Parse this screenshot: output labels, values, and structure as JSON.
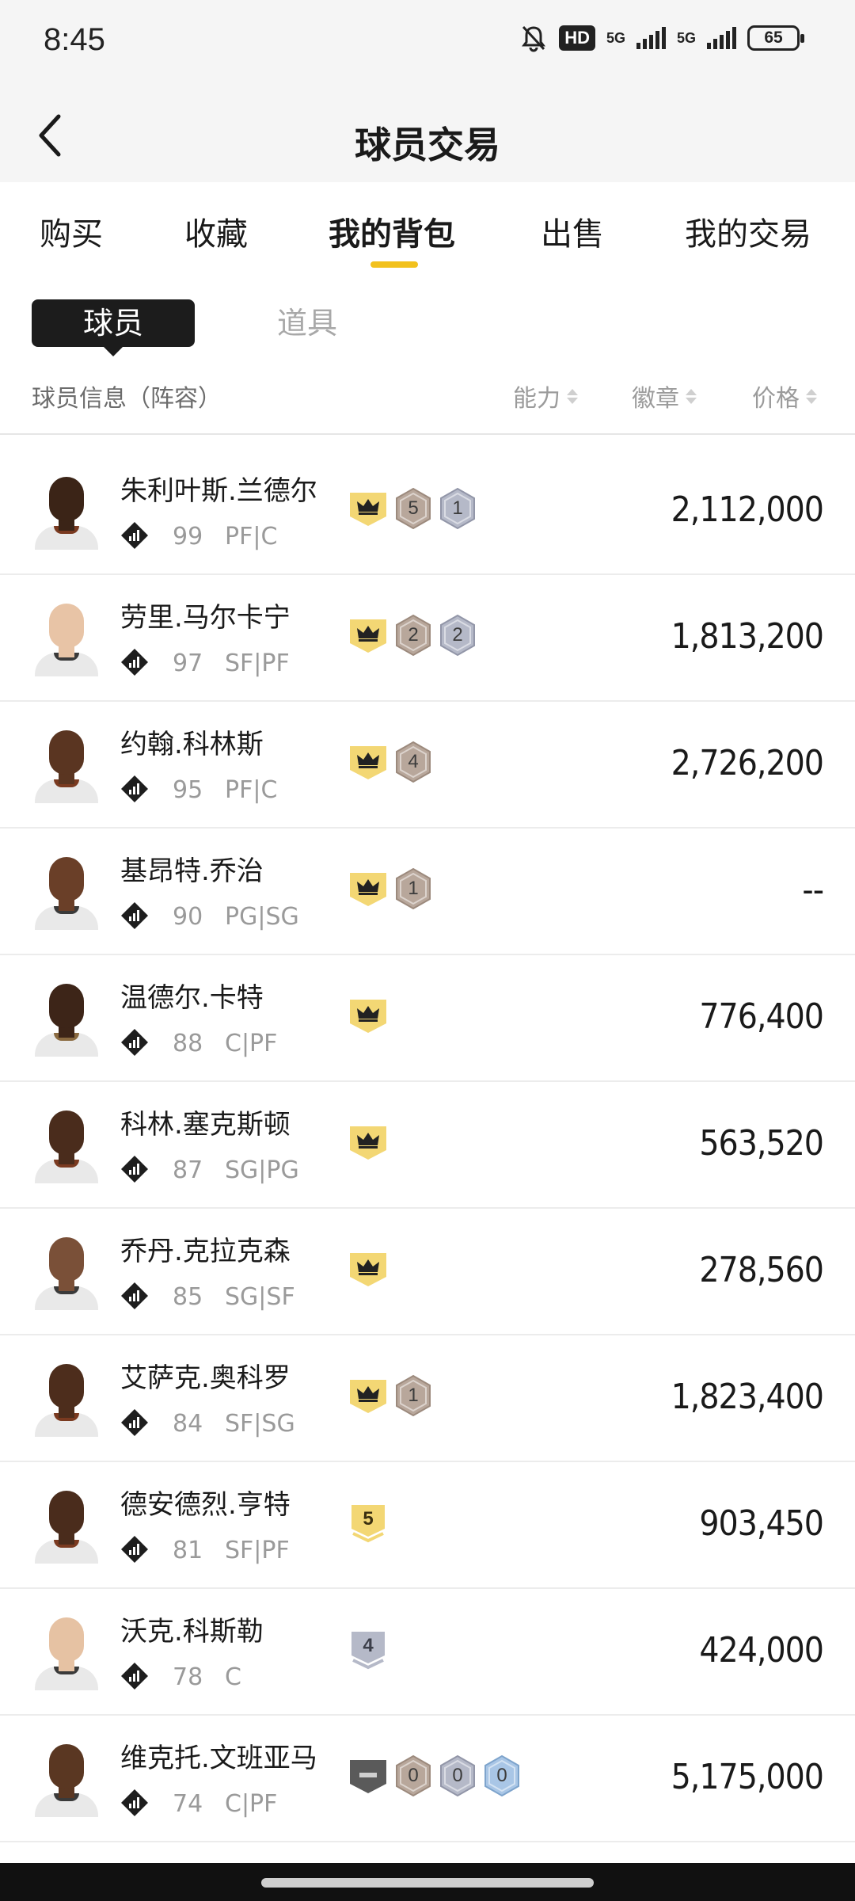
{
  "status_bar": {
    "time": "8:45",
    "hd": "HD",
    "net1": "5G",
    "net2": "5G",
    "battery": "65"
  },
  "header": {
    "title": "球员交易"
  },
  "tabs": [
    {
      "label": "购买",
      "active": false
    },
    {
      "label": "收藏",
      "active": false
    },
    {
      "label": "我的背包",
      "active": true
    },
    {
      "label": "出售",
      "active": false
    },
    {
      "label": "我的交易",
      "active": false
    }
  ],
  "segments": {
    "active": "球员",
    "inactive": "道具"
  },
  "columns": {
    "info": "球员信息（阵容）",
    "ability": "能力",
    "badges": "徽章",
    "price": "价格"
  },
  "colors": {
    "accent": "#f2c11d",
    "badge_gold": "#f3d774",
    "badge_bronze": "#b8a79b",
    "badge_silver": "#b5b9c8",
    "badge_blue": "#a9c6e6"
  },
  "players": [
    {
      "name": "朱利叶斯.兰德尔",
      "rating": "99",
      "position": "PF|C",
      "price": "2,112,000",
      "skin": "#3b2417",
      "jersey_trim": "#7a3a20",
      "badges": [
        {
          "type": "crown"
        },
        {
          "type": "hex",
          "color": "bronze",
          "value": "5"
        },
        {
          "type": "hex",
          "color": "silver",
          "value": "1"
        }
      ]
    },
    {
      "name": "劳里.马尔卡宁",
      "rating": "97",
      "position": "SF|PF",
      "price": "1,813,200",
      "skin": "#e8c4a6",
      "jersey_trim": "#3a3a3a",
      "badges": [
        {
          "type": "crown"
        },
        {
          "type": "hex",
          "color": "bronze",
          "value": "2"
        },
        {
          "type": "hex",
          "color": "silver",
          "value": "2"
        }
      ]
    },
    {
      "name": "约翰.科林斯",
      "rating": "95",
      "position": "PF|C",
      "price": "2,726,200",
      "skin": "#5a3521",
      "jersey_trim": "#7a3a20",
      "badges": [
        {
          "type": "crown"
        },
        {
          "type": "hex",
          "color": "bronze",
          "value": "4"
        }
      ]
    },
    {
      "name": "基昂特.乔治",
      "rating": "90",
      "position": "PG|SG",
      "price": "--",
      "skin": "#6a3f28",
      "jersey_trim": "#3a3a3a",
      "badges": [
        {
          "type": "crown"
        },
        {
          "type": "hex",
          "color": "bronze",
          "value": "1"
        }
      ]
    },
    {
      "name": "温德尔.卡特",
      "rating": "88",
      "position": "C|PF",
      "price": "776,400",
      "skin": "#3d2518",
      "jersey_trim": "#8a6a40",
      "badges": [
        {
          "type": "crown"
        }
      ]
    },
    {
      "name": "科林.塞克斯顿",
      "rating": "87",
      "position": "SG|PG",
      "price": "563,520",
      "skin": "#4a2c1c",
      "jersey_trim": "#7a3a20",
      "badges": [
        {
          "type": "crown"
        }
      ]
    },
    {
      "name": "乔丹.克拉克森",
      "rating": "85",
      "position": "SG|SF",
      "price": "278,560",
      "skin": "#7a5038",
      "jersey_trim": "#3a3a3a",
      "badges": [
        {
          "type": "crown"
        }
      ]
    },
    {
      "name": "艾萨克.奥科罗",
      "rating": "84",
      "position": "SF|SG",
      "price": "1,823,400",
      "skin": "#4d2d1c",
      "jersey_trim": "#7a3a20",
      "badges": [
        {
          "type": "crown"
        },
        {
          "type": "hex",
          "color": "bronze",
          "value": "1"
        }
      ]
    },
    {
      "name": "德安德烈.亨特",
      "rating": "81",
      "position": "SF|PF",
      "price": "903,450",
      "skin": "#4a2c1c",
      "jersey_trim": "#7a3a20",
      "badges": [
        {
          "type": "shield",
          "color": "gold",
          "value": "5"
        }
      ]
    },
    {
      "name": "沃克.科斯勒",
      "rating": "78",
      "position": "C",
      "price": "424,000",
      "skin": "#e6c2a3",
      "jersey_trim": "#3a3a3a",
      "badges": [
        {
          "type": "shield",
          "color": "silver",
          "value": "4"
        }
      ]
    },
    {
      "name": "维克托.文班亚马",
      "rating": "74",
      "position": "C|PF",
      "price": "5,175,000",
      "skin": "#5a3722",
      "jersey_trim": "#3a3a3a",
      "badges": [
        {
          "type": "dash"
        },
        {
          "type": "hex",
          "color": "bronze",
          "value": "0"
        },
        {
          "type": "hex",
          "color": "silver",
          "value": "0"
        },
        {
          "type": "hex",
          "color": "blue",
          "value": "0"
        }
      ]
    }
  ]
}
